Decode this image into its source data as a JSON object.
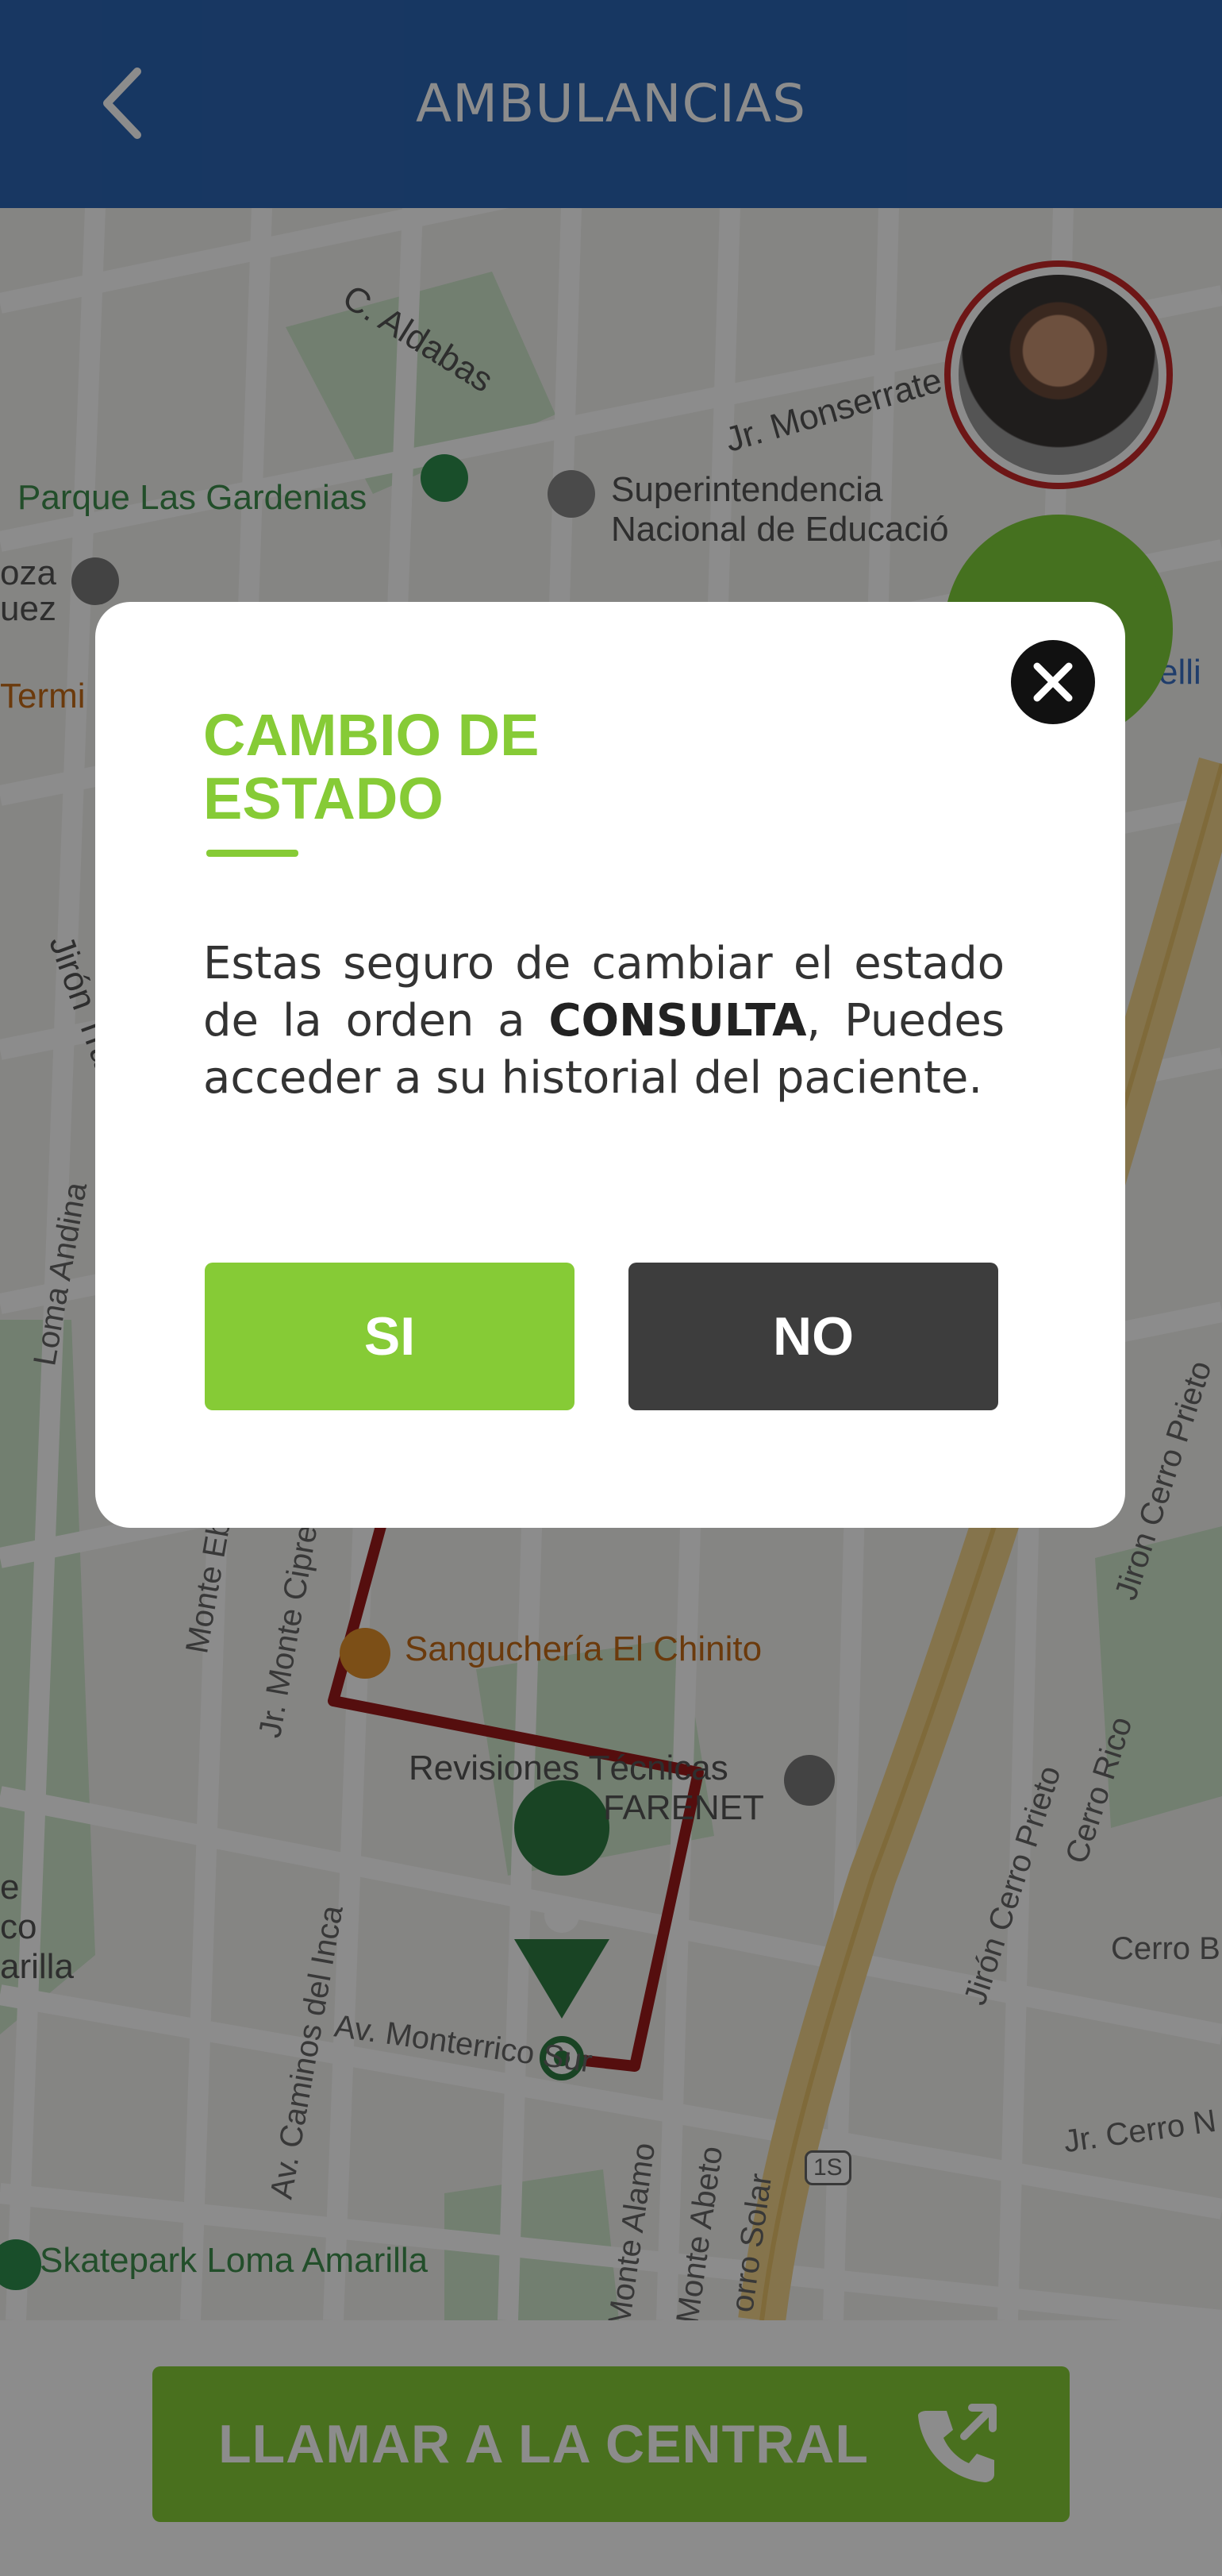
{
  "header": {
    "title": "AMBULANCIAS",
    "back_icon": "chevron-left-icon",
    "background": "#2b64b3"
  },
  "map": {
    "labels": [
      "C. Aldabas",
      "Jr. Monserrate",
      "Parque Las Gardenias",
      "Superintendencia",
      "Nacional de Educació",
      "oza",
      "uez",
      "Termi",
      "elli",
      "Jirón Tradic",
      "Loma Andina",
      "Monte Ebano",
      "Jr. Monte Cipres",
      "Sanguchería El Chinito",
      "Revisiones Técnicas",
      "FARENET",
      "Av. Caminos del Inca",
      "Av. Monterrico Sur",
      "Monte Alamo",
      "Monte Abeto",
      "orro Solar",
      "Jirón Cerro Prieto",
      "Jiron Cerro Prieto",
      "Cerro Rico",
      "Cerro Blan",
      "Jr. Cerro N",
      "Skatepark Loma Amarilla",
      "1S",
      "e",
      "co",
      "arilla"
    ],
    "route_color": "#9b1b1b"
  },
  "modal": {
    "title": "CAMBIO DE ESTADO",
    "text_before": "Estas seguro de cambiar el estado de la orden a ",
    "text_bold": "CONSULTA",
    "text_after": ", Puedes acceder a su historial del paciente.",
    "yes_label": "SI",
    "no_label": "NO",
    "close_icon": "close-icon",
    "accent": "#86cb36"
  },
  "bottom": {
    "call_label": "LLAMAR A LA CENTRAL",
    "call_icon": "phone-forward-icon"
  }
}
